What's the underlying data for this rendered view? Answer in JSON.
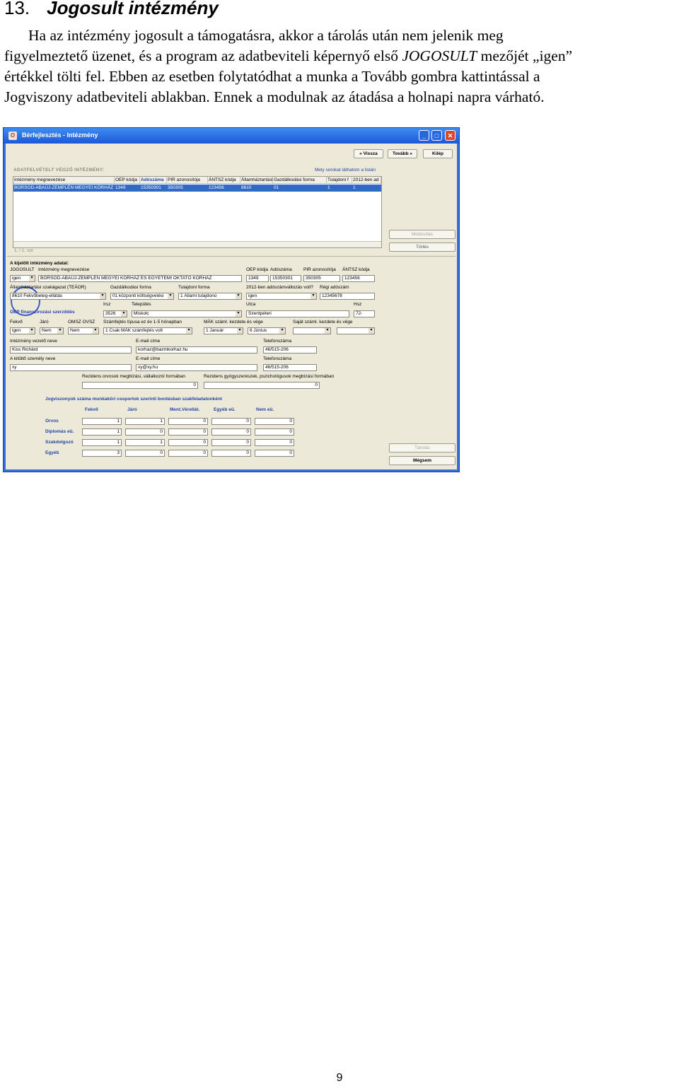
{
  "heading": {
    "number": "13.",
    "title": "Jogosult intézmény"
  },
  "paragraph": {
    "line1": "Ha az intézmény jogosult a támogatásra, akkor a tárolás után nem jelenik meg",
    "line2_a": "figyelmeztető üzenet, és a program az adatbeviteli képernyő első ",
    "line2_em": "JOGOSULT",
    "line2_b": " mezőjét „igen”",
    "line3": "értékkel tölti fel. Ebben az esetben folytatódhat a munka a Tovább gombra kattintással a",
    "line4": "Jogviszony adatbeviteli ablakban. Ennek a modulnak az átadása a holnapi napra várható."
  },
  "window": {
    "title": "Bérfejlesztés - Intézmény",
    "buttons": {
      "back": "« Vissza",
      "next": "Tovább »",
      "exit": "Kilép",
      "modify": "Módosítás",
      "delete": "Törlés",
      "save": "Tárolás",
      "cancel": "Mégsem"
    },
    "list_section": "ADATFELVÉTELT VÉGZŐ INTÉZMÉNY:",
    "list_hint": "Mely sorokat láthatom a listán",
    "columns": [
      "Intézmény megnevezése",
      "OEP kódja",
      "Adószáma",
      "PIR azonosítója",
      "ÁNTSZ kódja",
      "Államháztartási",
      "Gazdálkodási forma",
      "Tulajdoni f",
      "2012-ben ad"
    ],
    "row": [
      "BORSOD-ABAÚJ-ZEMPLÉN MEGYEI KÓRHÁZ",
      "1349",
      "15350301",
      "350305",
      "123456",
      "8610",
      "01",
      "1",
      "1"
    ],
    "record_counter": "1. / 1. sor",
    "selected_section": "A kijelölt intézmény adatai:",
    "labels": {
      "jogosult": "JOGOSULT",
      "name": "Intézmény megnevezése",
      "oep": "OEP kódja",
      "adoszam": "Adószáma",
      "pir": "PIR azonosítója",
      "antsz": "ÁNTSZ kódja",
      "szakagazat": "Államháztartási szakágazat (TEÁOR)",
      "gazd": "Gazdálkodási forma",
      "tulaj": "Tulajdoni forma",
      "adoszam_valt": "2012-ben adószámváltozás volt?",
      "regi_ado": "Régi adószám",
      "oep_fin": "OEP finanszírozási szerződés",
      "irsz": "Irsz",
      "telepules": "Település",
      "utca": "Utca",
      "hsz": "Hsz",
      "fekvo": "Fekvő",
      "jaro": "Járó",
      "omsz": "OMSZ OVSZ",
      "szamfej": "Számfejtés típusa ez év 1-5 hónapban",
      "mak": "MÁK száml. kezdete és vége",
      "sajat": "Saját száml. kezdete és vége",
      "vezeto": "Intézmény vezető neve",
      "email": "E-mail címe",
      "telefon": "Telefonszáma",
      "kitolto": "A kitöltő személy neve",
      "rez_orvos": "Rezidens orvosok megbízási, vállalkozói formában",
      "rez_gyogy": "Rezidens gyógyszerészek, pszichológusok megbízási formában"
    },
    "values": {
      "jogosult": "igen",
      "name": "BORSOD-ABAÚJ-ZEMPLÉN MEGYEI KÓRHÁZ ÉS EGYETEMI OKTATÓ KÓRHÁZ",
      "oep": "1349",
      "adoszam": "15350301",
      "pir": "350305",
      "antsz": "123456",
      "szakagazat": "8610 Fekvőbeteg-ellátás",
      "gazd": "01 központi költségvetési",
      "tulaj": "1 Állami tulajdonú",
      "adoszam_valt": "igen",
      "regi_ado": "12345678",
      "irsz": "3526",
      "telepules": "Miskolc",
      "utca": "Szentpéteri",
      "hsz": "72-",
      "fekvo": "igen",
      "jaro": "Nem",
      "omsz": "Nem",
      "szamfej": "1 Csak MÁK számfejtés volt",
      "mak_start": "1 Január",
      "mak_end": "6 Június",
      "vezeto": "Kiss Richárd",
      "email1": "korhaz@bazmkorhaz.hu",
      "tel1": "46/515-206",
      "kitolto": "xy",
      "email2": "xy@xy.hu",
      "tel2": "46/515-206",
      "rez_orvos": "0",
      "rez_gyogy": "0"
    },
    "table_title": "Jogviszonyok száma munkaköri csoportok szerinti bontásban szakfeladatonként",
    "table_cols": [
      "Fekvő",
      "Járó",
      "Ment.Vérellát.",
      "Egyéb eü.",
      "Nem eü."
    ],
    "table_rows": [
      {
        "label": "Orvos",
        "values": [
          "1",
          "1",
          "0",
          "0",
          "0"
        ]
      },
      {
        "label": "Diplomás eü.",
        "values": [
          "1",
          "0",
          "0",
          "0",
          "0"
        ]
      },
      {
        "label": "Szakdolgozó",
        "values": [
          "1",
          "1",
          "0",
          "0",
          "0"
        ]
      },
      {
        "label": "Egyéb",
        "values": [
          "3",
          "0",
          "0",
          "0",
          "0"
        ]
      }
    ]
  },
  "page_number": "9"
}
